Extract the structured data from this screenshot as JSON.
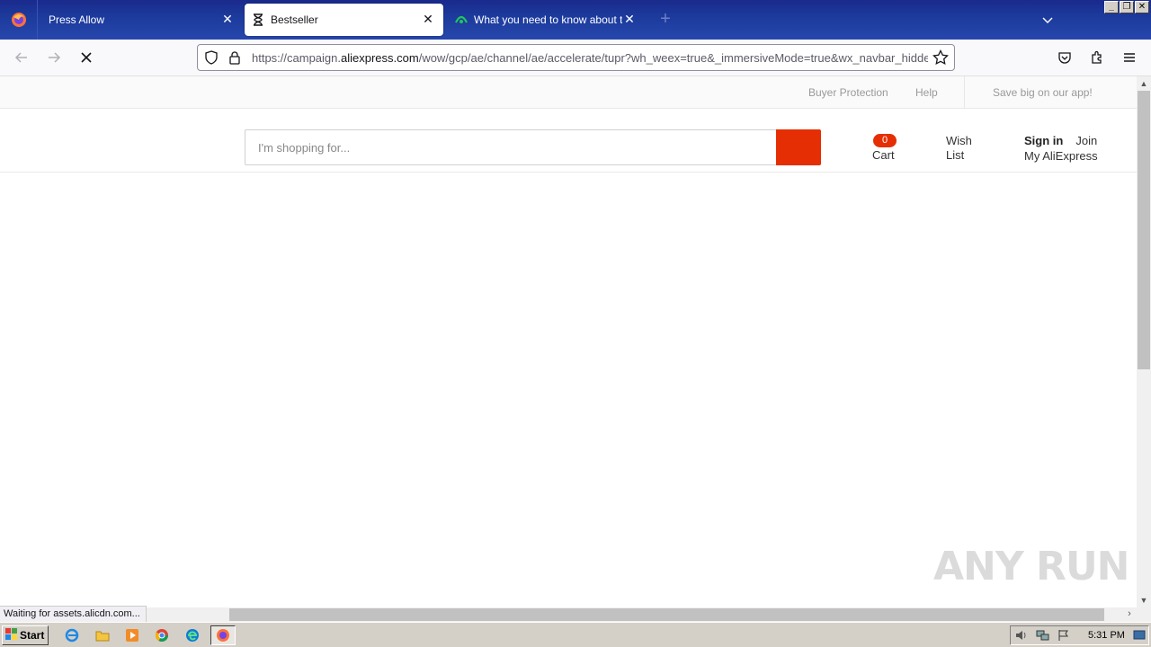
{
  "browser": {
    "tabs": [
      {
        "title": "Press Allow",
        "active": false
      },
      {
        "title": "Bestseller",
        "active": true
      },
      {
        "title": "What you need to know about the",
        "active": false
      }
    ],
    "url": {
      "prefix": "https://campaign.",
      "domain": "aliexpress.com",
      "path": "/wow/gcp/ae/channel/ae/accelerate/tupr?wh_weex=true&_immersiveMode=true&wx_navbar_hidden=true"
    },
    "status": "Waiting for assets.alicdn.com..."
  },
  "page": {
    "topbar": {
      "buyer_protection": "Buyer Protection",
      "help": "Help",
      "app": "Save big on our app!"
    },
    "search": {
      "placeholder": "I'm shopping for..."
    },
    "cart": {
      "count": "0",
      "label": "Cart"
    },
    "wishlist": {
      "line1": "Wish",
      "line2": "List"
    },
    "account": {
      "signin": "Sign in",
      "join": "Join",
      "my": "My AliExpress"
    }
  },
  "watermark": "ANY RUN",
  "taskbar": {
    "start": "Start",
    "clock": "5:31 PM"
  },
  "colors": {
    "accent": "#e62e04",
    "tabstrip": "#1c3a9c"
  }
}
